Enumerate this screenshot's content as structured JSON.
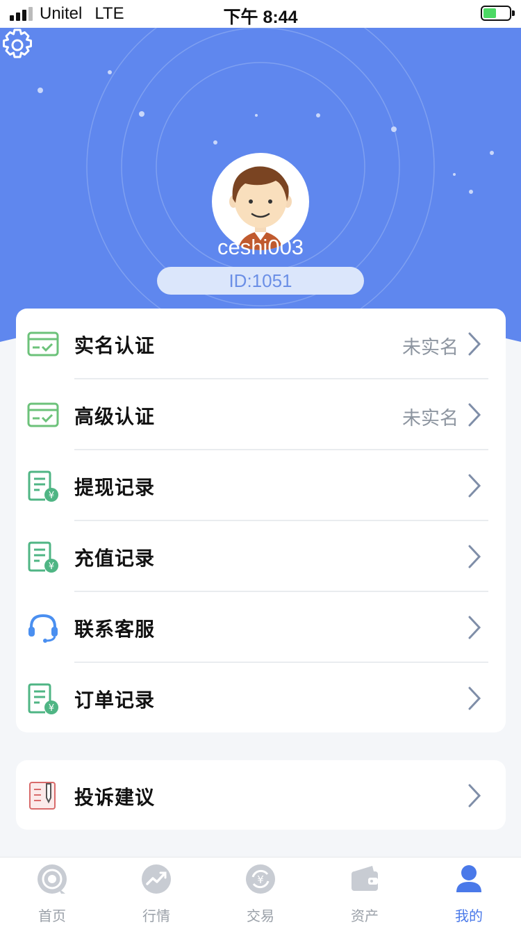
{
  "status_bar": {
    "carrier": "Unitel",
    "network": "LTE",
    "time": "下午 8:44"
  },
  "profile": {
    "username": "ceshi003",
    "id_label": "ID:1051"
  },
  "menu": [
    {
      "label": "实名认证",
      "value": "未实名",
      "icon": "verify-card-icon"
    },
    {
      "label": "高级认证",
      "value": "未实名",
      "icon": "verify-card-icon"
    },
    {
      "label": "提现记录",
      "value": "",
      "icon": "record-yen-icon"
    },
    {
      "label": "充值记录",
      "value": "",
      "icon": "record-yen-icon"
    },
    {
      "label": "联系客服",
      "value": "",
      "icon": "headset-icon"
    },
    {
      "label": "订单记录",
      "value": "",
      "icon": "record-yen-icon"
    }
  ],
  "menu2": [
    {
      "label": "投诉建议",
      "value": "",
      "icon": "complaint-note-icon"
    }
  ],
  "tabs": [
    {
      "label": "首页",
      "icon": "home-icon",
      "active": false
    },
    {
      "label": "行情",
      "icon": "market-trend-icon",
      "active": false
    },
    {
      "label": "交易",
      "icon": "trade-icon",
      "active": false
    },
    {
      "label": "资产",
      "icon": "wallet-icon",
      "active": false
    },
    {
      "label": "我的",
      "icon": "user-icon",
      "active": true
    }
  ],
  "colors": {
    "brand_blue": "#5f87ee",
    "active_tab": "#4a79e9",
    "icon_green": "#6cc27a",
    "chevron": "#7f8ea8"
  }
}
